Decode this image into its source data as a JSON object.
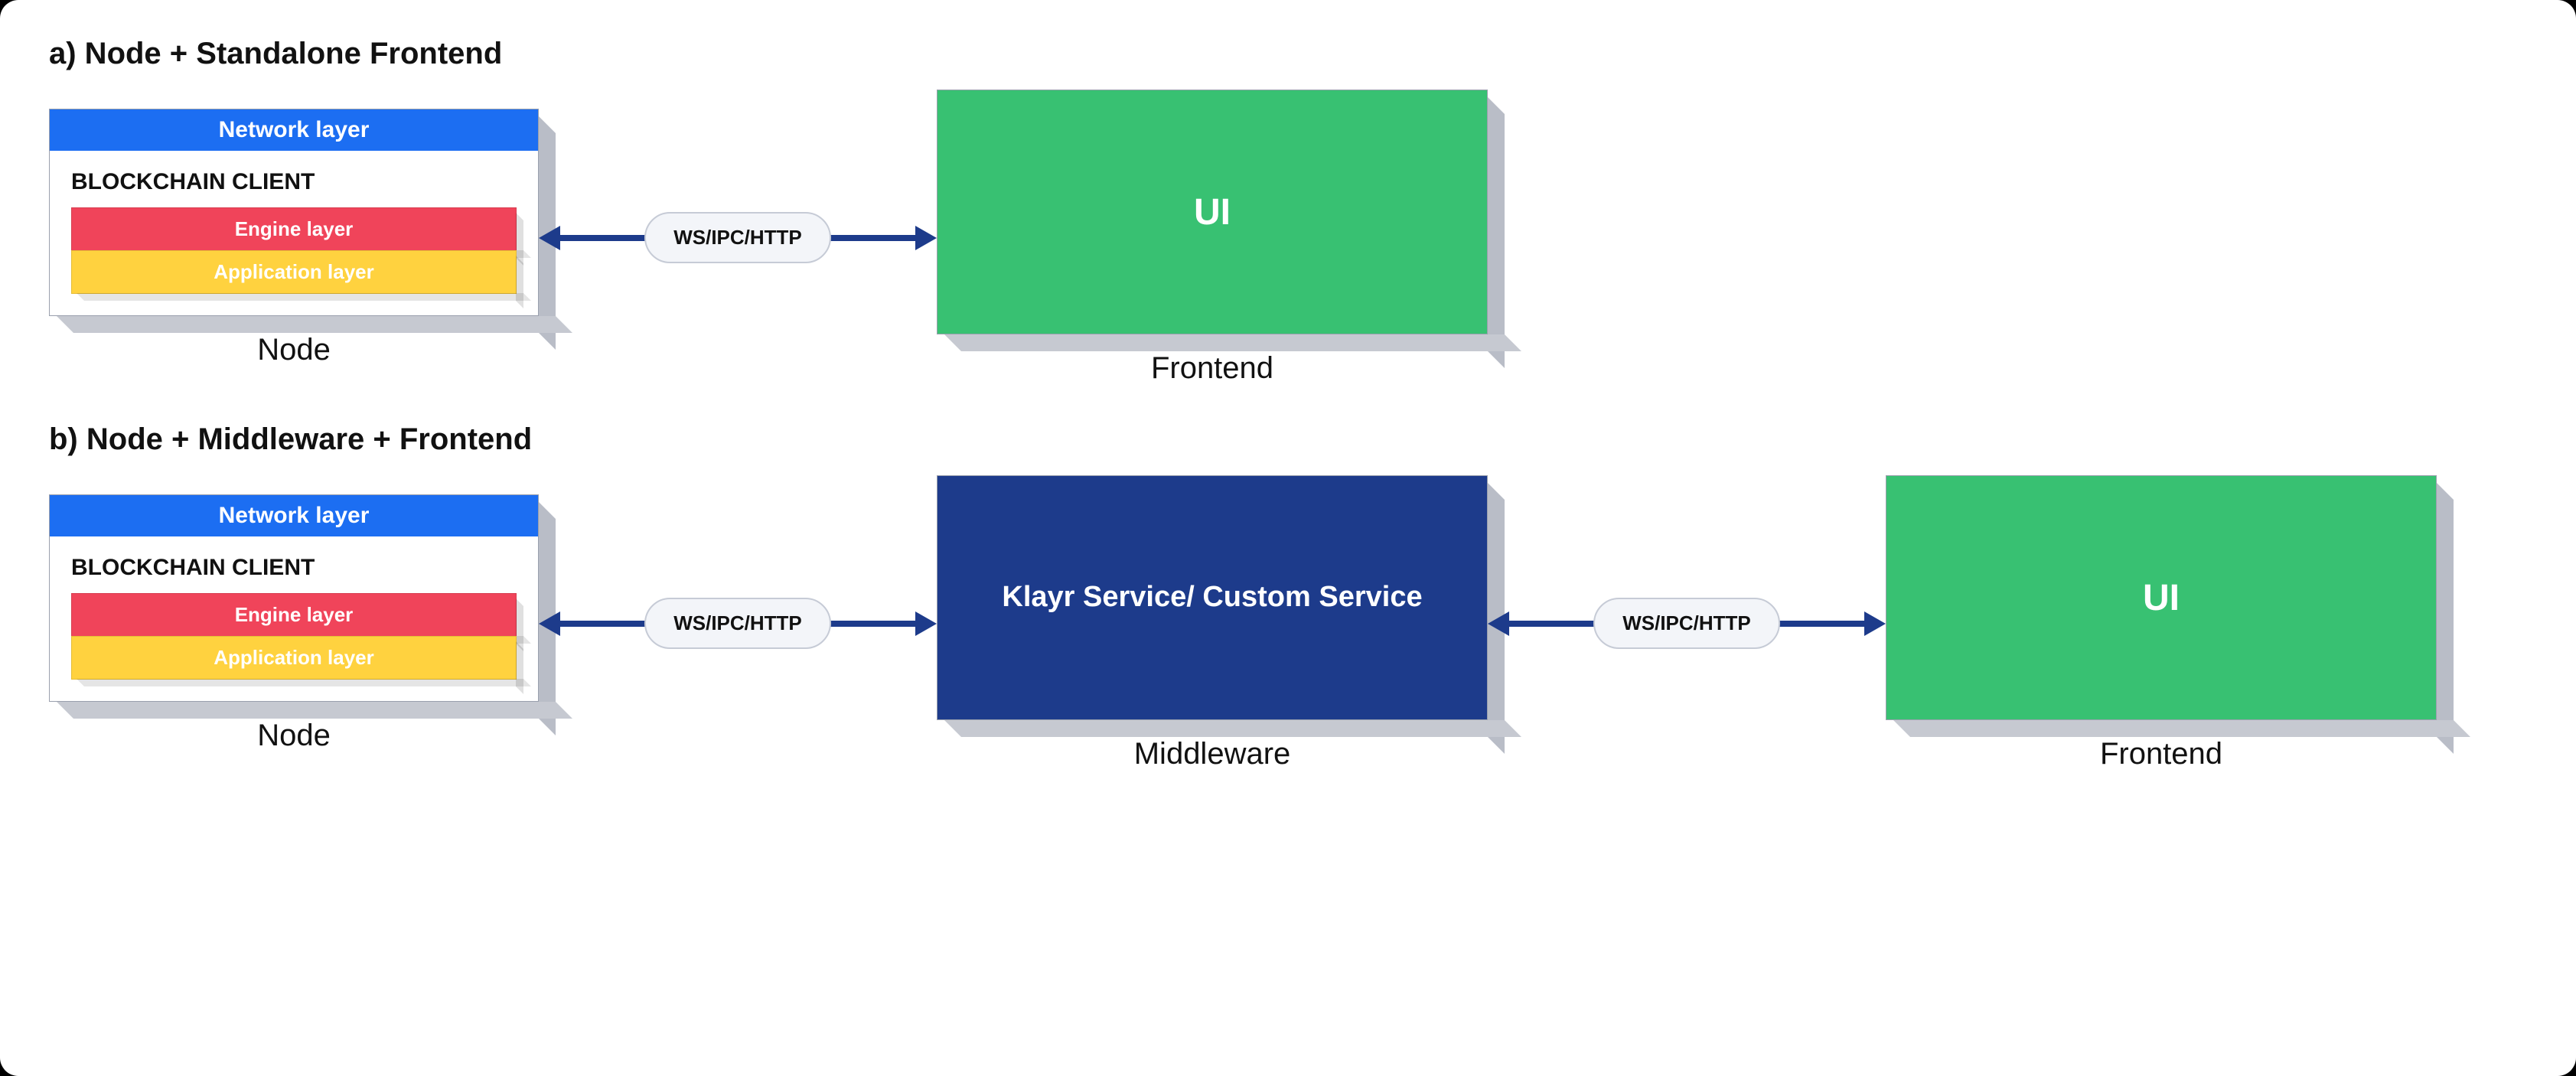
{
  "sections": {
    "a": {
      "title": "a) Node + Standalone Frontend",
      "node": {
        "network_layer": "Network layer",
        "client_title": "BLOCKCHAIN CLIENT",
        "engine_layer": "Engine layer",
        "application_layer": "Application layer",
        "caption": "Node"
      },
      "connector_ab": "WS/IPC/HTTP",
      "frontend": {
        "label": "UI",
        "caption": "Frontend"
      }
    },
    "b": {
      "title": "b) Node + Middleware + Frontend",
      "node": {
        "network_layer": "Network layer",
        "client_title": "BLOCKCHAIN CLIENT",
        "engine_layer": "Engine layer",
        "application_layer": "Application layer",
        "caption": "Node"
      },
      "connector_nm": "WS/IPC/HTTP",
      "middleware": {
        "label": "Klayr Service/ Custom Service",
        "caption": "Middleware"
      },
      "connector_mf": "WS/IPC/HTTP",
      "frontend": {
        "label": "UI",
        "caption": "Frontend"
      }
    }
  },
  "colors": {
    "network_layer": "#1c6ef2",
    "engine_layer": "#f0445a",
    "application_layer": "#ffd23f",
    "ui_box": "#38c172",
    "middleware_box": "#1d3b8b",
    "arrow": "#1d3b8b"
  }
}
